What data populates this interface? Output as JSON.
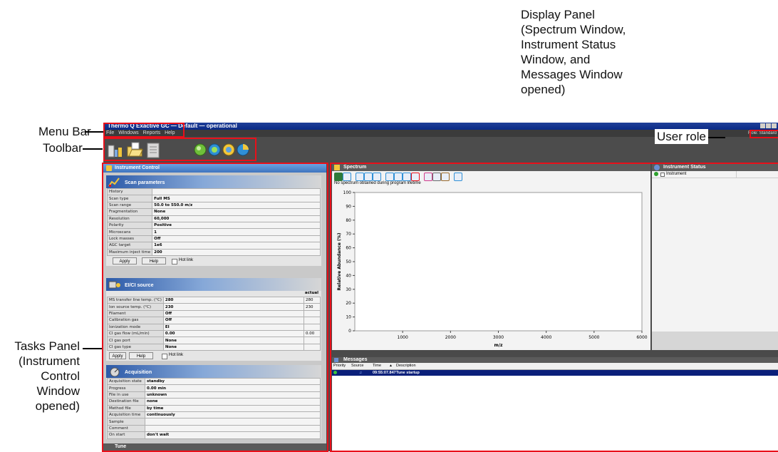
{
  "callouts": {
    "display_panel": [
      "Display Panel",
      "(Spectrum Window,",
      "Instrument Status",
      "Window, and",
      "Messages Window",
      "opened)"
    ],
    "menu_bar": "Menu Bar",
    "toolbar": "Toolbar",
    "user_role": "User role",
    "tasks_panel": [
      "Tasks Panel",
      "(Instrument",
      "Control",
      "Window",
      "opened)"
    ]
  },
  "window": {
    "title": "Thermo Q Exactive GC — Default — operational",
    "menu": [
      "File",
      "Windows",
      "Reports",
      "Help"
    ],
    "role": "Role:  Standard"
  },
  "toolbar_icons": [
    "instrument-icon",
    "folder-open-icon",
    "document-icon",
    "green-circle-icon",
    "blue-circle-icon",
    "yellow-circle-icon",
    "pie-icon"
  ],
  "tasks": {
    "title": "Instrument Control",
    "scan": {
      "title": "Scan parameters",
      "rows": [
        {
          "k": "History",
          "v": ""
        },
        {
          "k": "Scan type",
          "v": "Full MS"
        },
        {
          "k": "Scan range",
          "v": "50.0 to 550.0 m/z"
        },
        {
          "k": "Fragmentation",
          "v": "None"
        },
        {
          "k": "Resolution",
          "v": "60,000"
        },
        {
          "k": "Polarity",
          "v": "Positive"
        },
        {
          "k": "Microscans",
          "v": "1"
        },
        {
          "k": "Lock masses",
          "v": "Off"
        },
        {
          "k": "AGC target",
          "v": "1e6"
        },
        {
          "k": "Maximum inject time",
          "v": "200"
        }
      ],
      "apply": "Apply",
      "help": "Help",
      "hotlink": "Hot link"
    },
    "source": {
      "title": "EI/CI source",
      "actual_header": "actual",
      "rows": [
        {
          "k": "MS transfer line temp. (°C)",
          "v": "280",
          "a": "280"
        },
        {
          "k": "Ion source temp. (°C)",
          "v": "230",
          "a": "230"
        },
        {
          "k": "Filament",
          "v": "Off",
          "a": ""
        },
        {
          "k": "Calibration gas",
          "v": "Off",
          "a": ""
        },
        {
          "k": "Ionization mode",
          "v": "EI",
          "a": ""
        },
        {
          "k": "CI gas flow (mL/min)",
          "v": "0.00",
          "a": "0.00"
        },
        {
          "k": "CI gas port",
          "v": "None",
          "a": ""
        },
        {
          "k": "CI gas type",
          "v": "None",
          "a": ""
        }
      ],
      "apply": "Apply",
      "help": "Help",
      "hotlink": "Hot link"
    },
    "acq": {
      "title": "Acquisition",
      "rows": [
        {
          "k": "Acquisition state",
          "v": "standby"
        },
        {
          "k": "Progress",
          "v": "0.00 min"
        },
        {
          "k": "File in use",
          "v": "unknown"
        },
        {
          "k": "Destination file",
          "v": "none"
        },
        {
          "k": "Method file",
          "v": "by time"
        },
        {
          "k": "Acquisition time",
          "v": "continuously"
        },
        {
          "k": "Sample",
          "v": ""
        },
        {
          "k": "Comment",
          "v": ""
        },
        {
          "k": "On start",
          "v": "don't wait"
        }
      ]
    },
    "tune": "Tune"
  },
  "spectrum": {
    "title": "Spectrum",
    "message": "No spectrum obtained during program lifetime"
  },
  "status": {
    "title": "Instrument Status",
    "item": "Instrument"
  },
  "messages": {
    "title": "Messages",
    "columns": [
      "Priority",
      "Source",
      "Time",
      "Description"
    ],
    "rows": [
      {
        "time": "09:55:07.847",
        "description": "Tune startup"
      }
    ]
  },
  "chart_data": {
    "type": "line",
    "xlabel": "m/z",
    "ylabel": "Relative Abundance (%)",
    "xlim": [
      0,
      6000
    ],
    "ylim": [
      0,
      100
    ],
    "x_ticks": [
      1000,
      2000,
      3000,
      4000,
      5000,
      6000
    ],
    "y_ticks": [
      0,
      10,
      20,
      30,
      40,
      50,
      60,
      70,
      80,
      90,
      100
    ],
    "series": []
  },
  "colors": {
    "annotation_red": "#e8101a",
    "title_blue": "#0a2a86",
    "selected_row": "#0a1f7a"
  }
}
